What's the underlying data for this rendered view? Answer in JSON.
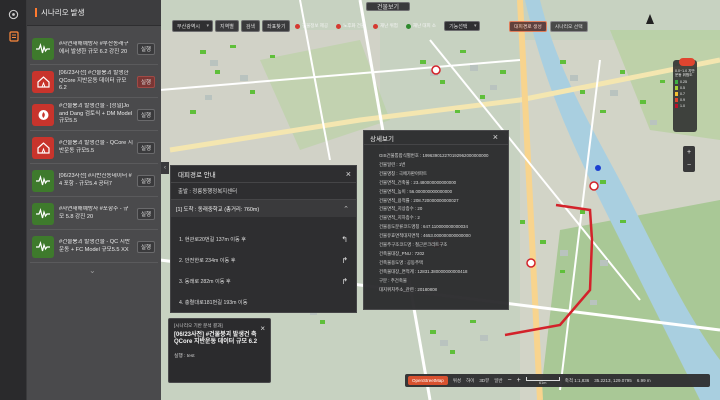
{
  "scenario_panel": {
    "title": "시나리오 발생",
    "items": [
      {
        "icon": "earthquake-icon",
        "color": "green",
        "text": "#자연재해예방사 #부산동래구에서 발생한 규모 6.2 강진 20",
        "button": "실행",
        "active": false
      },
      {
        "icon": "house-collapse-icon",
        "color": "red",
        "text": "[06/23사전] #건물붕괴 발생한 QCore 지반운동 데이터 규모6.2",
        "button": "실행",
        "active": true
      },
      {
        "icon": "house-fire-icon",
        "color": "red",
        "text": "#건물붕괴 발생건물 - [정밀]Jo and Dang 검토식 + DM Model 규모5.5",
        "button": "실행",
        "active": false
      },
      {
        "icon": "house-collapse-icon",
        "color": "red",
        "text": "#건물붕괴 발생건물 - QCore 지반운동 규모5.5",
        "button": "실행",
        "active": false
      },
      {
        "icon": "earthquake-icon",
        "color": "green",
        "text": "[06/23사전] #지반진동데이터 # 4 포항 - 규모5.4 공터7",
        "button": "실행",
        "active": false
      },
      {
        "icon": "earthquake-icon",
        "color": "green",
        "text": "#자연재해예방사 #포항주 - 규모 5.8 강진 20",
        "button": "실행",
        "active": false
      },
      {
        "icon": "earthquake-icon",
        "color": "green",
        "text": "#건물붕괴 발생건물 - QC 지반운동 + FC Model 규모5.5 XX",
        "button": "실행",
        "active": false
      }
    ],
    "more": "⌄"
  },
  "toolbar": {
    "region_select": "부산광역시",
    "buttons": [
      "지역별",
      "검색",
      "좌표찾기"
    ],
    "overlays": [
      {
        "label": "건물정보 제공"
      },
      {
        "label": "노후화 건물"
      },
      {
        "label": "재난 위험"
      },
      {
        "label": "재난 대피 소"
      }
    ],
    "layer_select": "기능선택",
    "map_title": "건물보기",
    "right_buttons": [
      {
        "label": "대피경로 생성",
        "style": "accent"
      },
      {
        "label": "시나리오 선택",
        "style": "plain"
      }
    ]
  },
  "legend": {
    "title": "0.0~1.0 지반운동 위험도",
    "items": [
      {
        "label": "0.25",
        "color": "#3cb043"
      },
      {
        "label": "0.5",
        "color": "#a4d233"
      },
      {
        "label": "0.7",
        "color": "#f2c231"
      },
      {
        "label": "0.9",
        "color": "#e0452f"
      },
      {
        "label": "1.0",
        "color": "#b8102a"
      }
    ]
  },
  "route_panel": {
    "title": "대피경로 안내",
    "departure": "출발 : 정릉동행정복지센터",
    "arrival": "[1] 도착 : 동래중학교 (총거리: 760m)",
    "steps": [
      {
        "text": "1. 현관로20번길 137m 이동 후",
        "turn": "↰"
      },
      {
        "text": "2. 안전한로 234m 이동 후",
        "turn": "↱"
      },
      {
        "text": "3. 동래로 282m 이동 후",
        "turn": "↱"
      },
      {
        "text": "4. 충렬대로181번길 193m 이동",
        "turn": ""
      }
    ]
  },
  "info_popup": {
    "caption": "[시나리오 기반 분석 결과]",
    "name": "[06/23사전] #건물붕괴 발생건 축 QCore 지반운동 데이터 규모 6.2",
    "user": "실행 : test"
  },
  "detail_panel": {
    "title": "상세보기",
    "rows": [
      "GIS건물통합식별번호 : 199639012270192962000000000",
      "건물일련 : 1번",
      "건물명칭 : 극에가판아파트",
      "건물면적_건축물 : 23.480000000000000",
      "건물면적_높이 : 56.000000000000000",
      "건물면적_용적률 : 208.720000000000027",
      "건물면적_지상층수 : 20",
      "건물면적_지하층수 : 2",
      "건물용도분류코드명칭 : 647.110000000000034",
      "건물유효면적대지면적 : 4653.000000000000000",
      "건물주구조코드명 : 철근콘크리트구조",
      "건축물대장_PNU : 7202",
      "건축물용도명 : 공동주택",
      "건축물대장_면적계 : 12831.380000000000418",
      "구분 : 주건축물",
      "대지위치주소_관련 : 20180808"
    ]
  },
  "status_bar": {
    "basemap": "OpenStreetMap",
    "controls": [
      "위성",
      "하이",
      "3D뷰",
      "일반"
    ],
    "zoom_minus": "−",
    "zoom_plus": "+",
    "scale": "61m",
    "scale_text": "축척 1:1,836",
    "coords": "35.2213, 129.0795",
    "altitude": "6.99 m"
  },
  "colors": {
    "accent": "#ff7a2f",
    "panel_bg": "#2e2e30",
    "route": "#d3222a"
  }
}
